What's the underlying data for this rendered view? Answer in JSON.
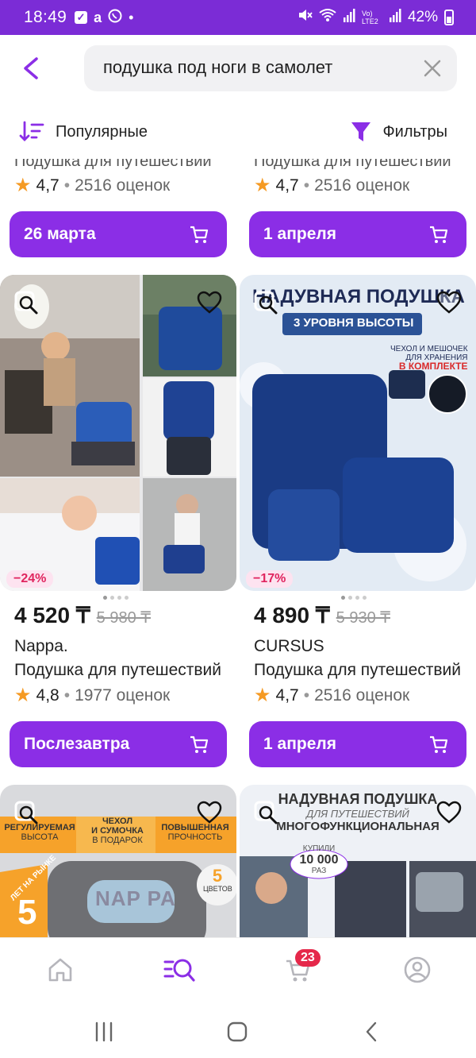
{
  "status_bar": {
    "time": "18:49",
    "notif_a": "a",
    "battery": "42%",
    "network": "Vo) LTE2"
  },
  "search": {
    "query": "подушка под ноги в самолет"
  },
  "sortbar": {
    "sort_label": "Популярные",
    "filter_label": "Фильтры"
  },
  "products_top": [
    {
      "title_cut": "Подушка для путешествий",
      "rating": "4,7",
      "reviews": "2516 оценок",
      "delivery": "26 марта"
    },
    {
      "title_cut": "Подушка для путешествий",
      "rating": "4,7",
      "reviews": "2516 оценок",
      "delivery": "1 апреля"
    }
  ],
  "products": [
    {
      "discount": "−24%",
      "price": "4 520 ₸",
      "old_price": "5 980 ₸",
      "brand": "Nappa.",
      "title": "Подушка для путешествий",
      "rating": "4,8",
      "reviews": "1977 оценок",
      "delivery": "Послезавтра"
    },
    {
      "discount": "−17%",
      "price": "4 890 ₸",
      "old_price": "5 930 ₸",
      "brand": "CURSUS",
      "title": "Подушка для путешествий",
      "rating": "4,7",
      "reviews": "2516 оценок",
      "delivery": "1 апреля",
      "image_text": {
        "headline": "НАДУВНАЯ ПОДУШКА",
        "badge": "3 УРОВНЯ ВЫСОТЫ",
        "note1": "ЧЕХОЛ И МЕШОЧЕК",
        "note2": "ДЛЯ ХРАНЕНИЯ",
        "note3": "В КОМПЛЕКТЕ"
      }
    }
  ],
  "products_bottom": [
    {
      "image_text": {
        "f1a": "РЕГУЛИРУЕМАЯ",
        "f1b": "ВЫСОТА",
        "f2a": "ЧЕХОЛ",
        "f2b": "И СУМОЧКА",
        "f2c": "В ПОДАРОК",
        "f3a": "ПОВЫШЕННАЯ",
        "f3b": "ПРОЧНОСТЬ",
        "years_text": "ЛЕТ НА РЫНКЕ",
        "years": "5",
        "colors_num": "5",
        "colors_text": "ЦВЕТОВ",
        "logo": "NAP PA"
      }
    },
    {
      "image_text": {
        "l1": "НАДУВНАЯ ПОДУШКА",
        "l2": "ДЛЯ ПУТЕШЕСТВИЙ",
        "l3": "МНОГОФУНКЦИОНАЛЬНАЯ",
        "k1": "КУПИЛИ",
        "k2": "10 000",
        "k3": "РАЗ"
      }
    }
  ],
  "bottom_nav": {
    "cart_badge": "23"
  },
  "colors": {
    "accent": "#8b2ee6",
    "status_bar": "#7b2cd6",
    "discount_text": "#e0245e",
    "star": "#f59a23"
  }
}
